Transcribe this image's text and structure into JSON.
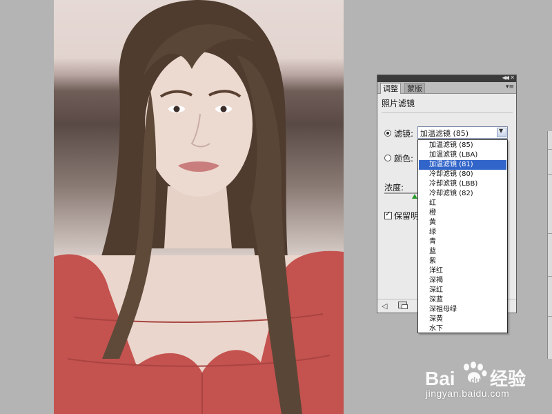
{
  "panel": {
    "tabs": [
      "调整",
      "蒙版"
    ],
    "title": "照片滤镜",
    "filter_label": "滤镜:",
    "color_label": "颜色:",
    "density_label": "浓度:",
    "preserve_label": "保留明",
    "preserve_checked": true,
    "filter_selected": true,
    "color_selected": false,
    "icons": {
      "collapse": "double-chevron-left-icon",
      "close": "close-icon",
      "menu": "panel-menu-icon",
      "back": "back-arrow-icon",
      "clip": "clip-to-layer-icon"
    }
  },
  "filter_select": {
    "value": "加温滤镜 (85)"
  },
  "dropdown": {
    "options": [
      "加温滤镜 (85)",
      "加温滤镜 (LBA)",
      "加温滤镜 (81)",
      "冷却滤镜 (80)",
      "冷却滤镜 (LBB)",
      "冷却滤镜 (82)",
      "红",
      "橙",
      "黄",
      "绿",
      "青",
      "蓝",
      "紫",
      "洋红",
      "深褐",
      "深红",
      "深蓝",
      "深祖母绿",
      "深黄",
      "水下"
    ],
    "selected_index": 2
  },
  "watermark": {
    "logo_text": "Baidu经验",
    "url": "jingyan.baidu.com"
  },
  "colors": {
    "selection": "#3265c9",
    "dress": "#c4524f",
    "hair": "#5a4636",
    "skin": "#ecd9d0"
  }
}
